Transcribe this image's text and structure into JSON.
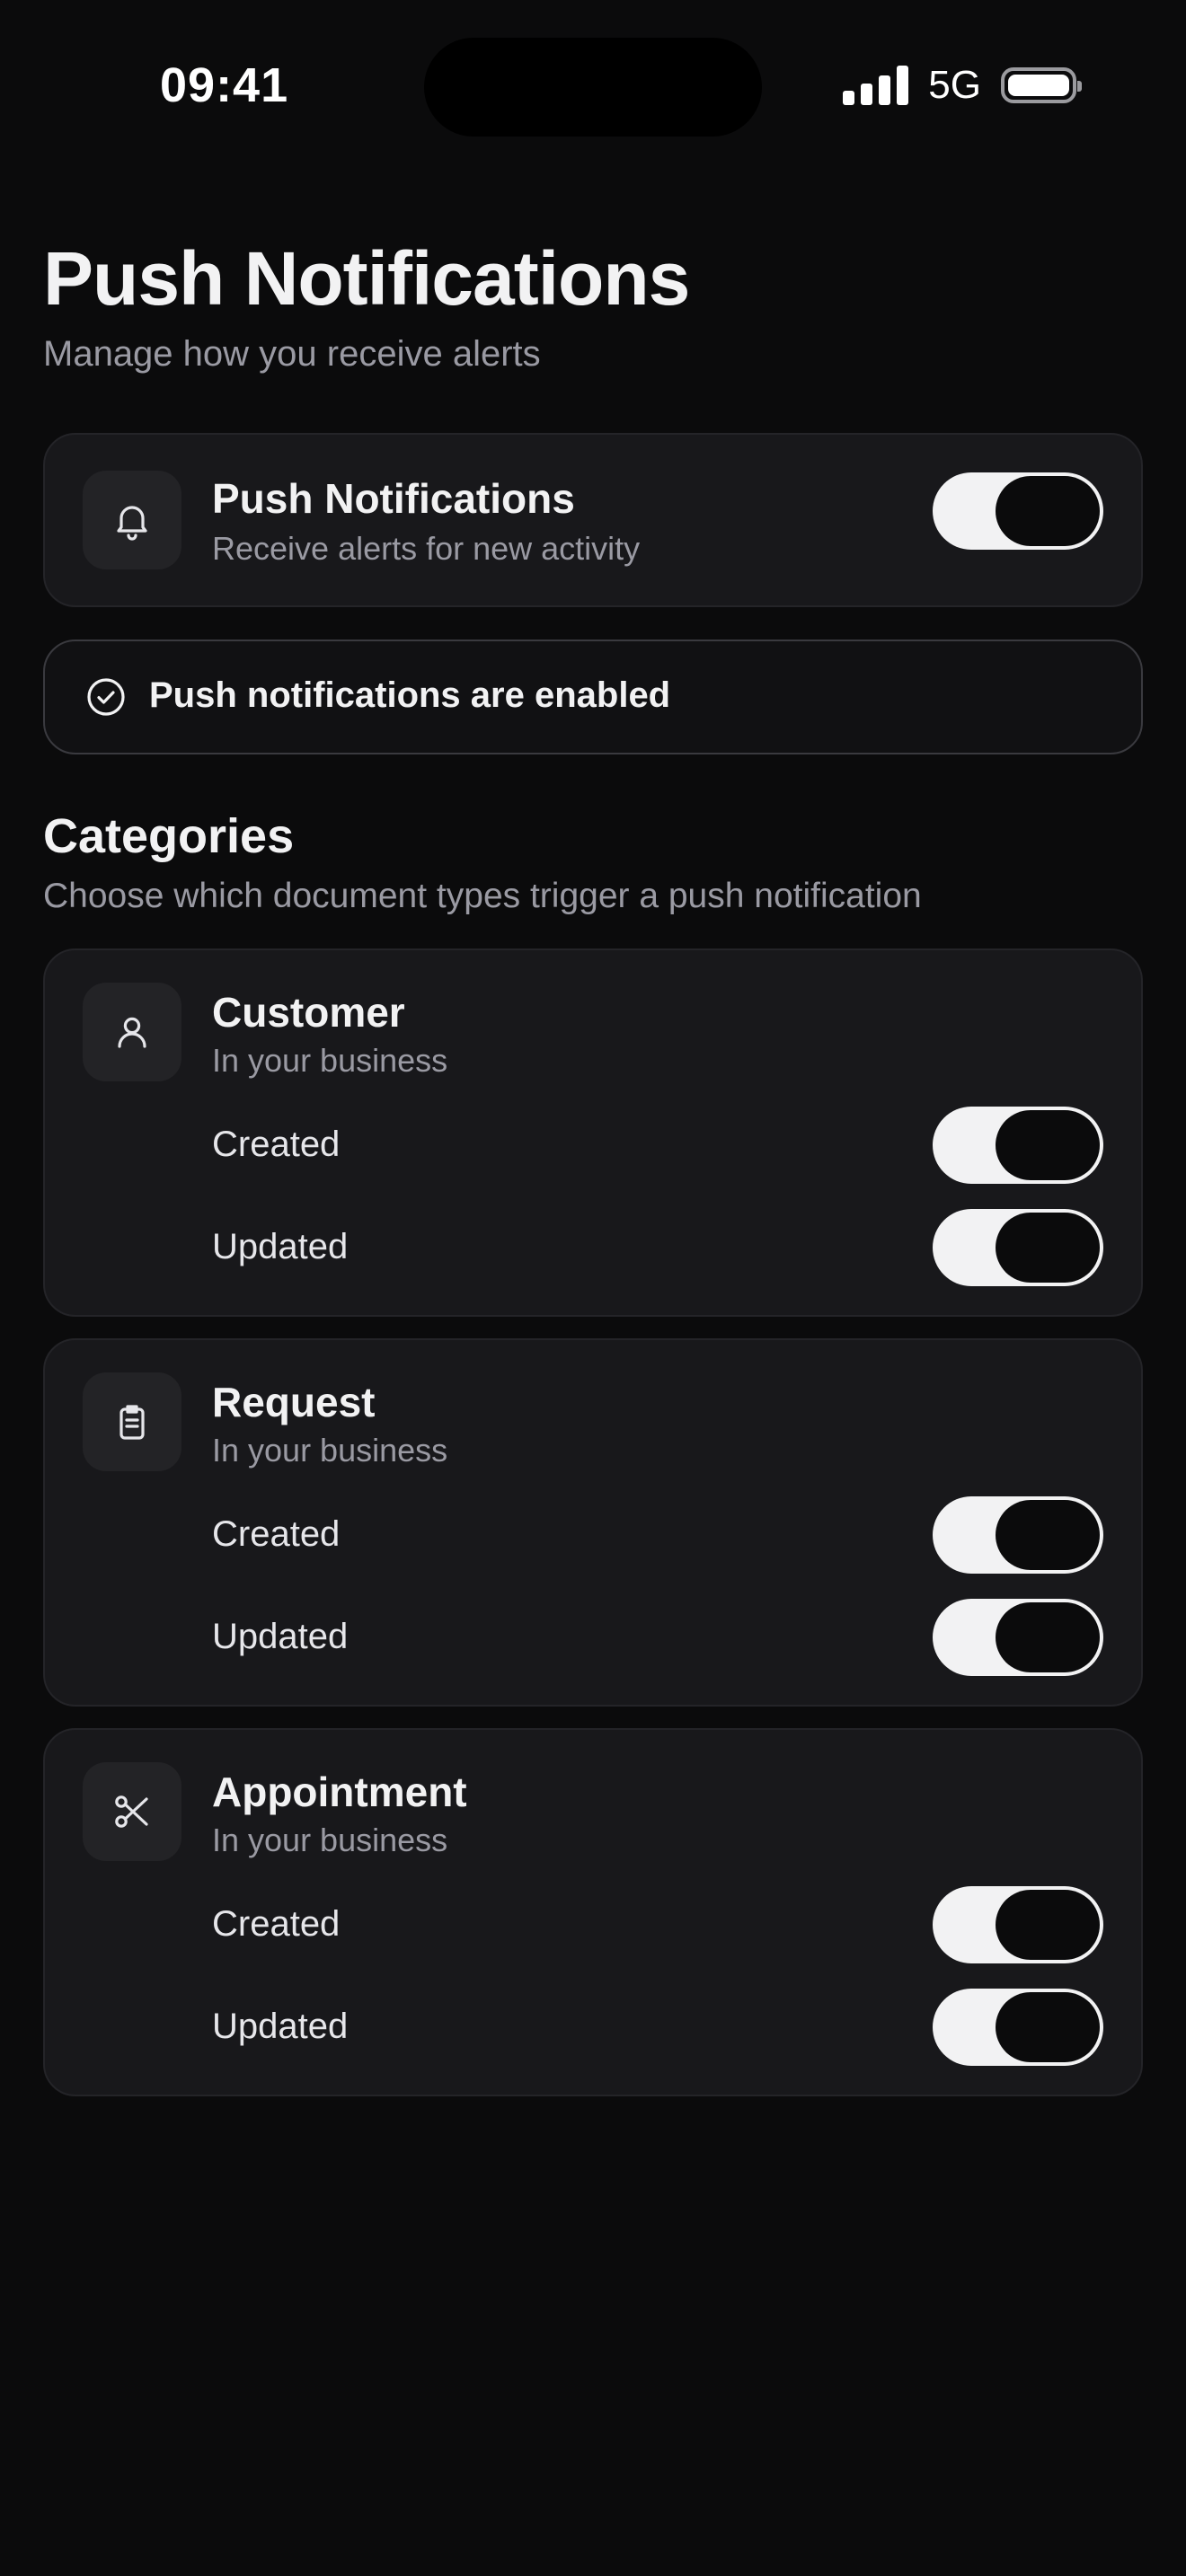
{
  "status_bar": {
    "time": "09:41",
    "network": "5G"
  },
  "header": {
    "title": "Push Notifications",
    "subtitle": "Manage how you receive alerts"
  },
  "master": {
    "icon": "bell-icon",
    "title": "Push Notifications",
    "subtitle": "Receive alerts for new activity",
    "enabled": true
  },
  "status_banner": {
    "icon": "check-circle-icon",
    "text": "Push notifications are enabled"
  },
  "categories": {
    "title": "Categories",
    "subtitle": "Choose which document types trigger a push notification",
    "items": [
      {
        "icon": "user-icon",
        "title": "Customer",
        "subtitle": "In your business",
        "events": [
          {
            "label": "Created",
            "enabled": true
          },
          {
            "label": "Updated",
            "enabled": true
          }
        ]
      },
      {
        "icon": "clipboard-icon",
        "title": "Request",
        "subtitle": "In your business",
        "events": [
          {
            "label": "Created",
            "enabled": true
          },
          {
            "label": "Updated",
            "enabled": true
          }
        ]
      },
      {
        "icon": "scissors-icon",
        "title": "Appointment",
        "subtitle": "In your business",
        "events": [
          {
            "label": "Created",
            "enabled": true
          },
          {
            "label": "Updated",
            "enabled": true
          }
        ]
      }
    ]
  },
  "colors": {
    "background": "#0b0b0c",
    "card": "#18181b",
    "text_primary": "#f2f2f3",
    "text_secondary": "#9a9aa3",
    "toggle_track": "#f2f2f3"
  }
}
